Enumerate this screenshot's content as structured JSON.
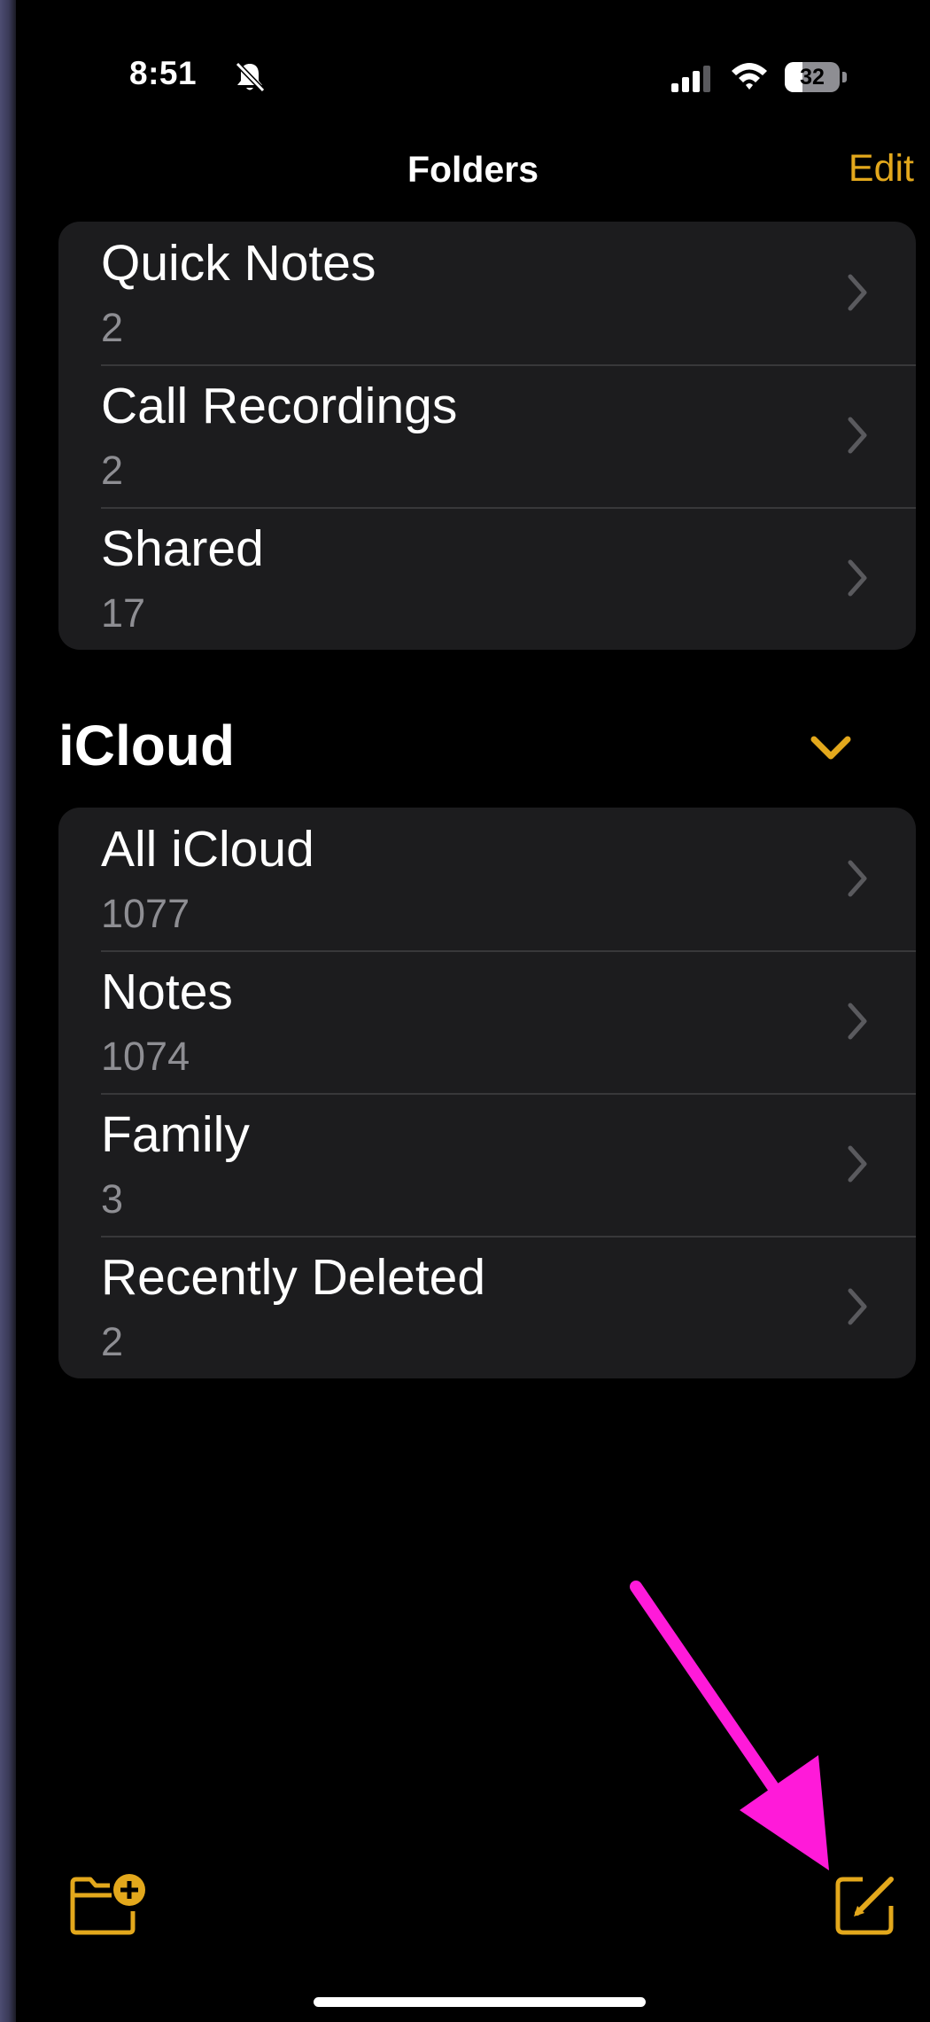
{
  "status_bar": {
    "time": "8:51",
    "battery_level": "32",
    "battery_fraction": 0.32,
    "icons": [
      "bell-slash-icon",
      "signal-icon",
      "wifi-icon",
      "battery-icon"
    ]
  },
  "nav": {
    "title": "Folders",
    "edit_label": "Edit"
  },
  "top_folders": [
    {
      "name": "Quick Notes",
      "count": "2"
    },
    {
      "name": "Call Recordings",
      "count": "2"
    },
    {
      "name": "Shared",
      "count": "17"
    }
  ],
  "icloud": {
    "title": "iCloud",
    "folders": [
      {
        "name": "All iCloud",
        "count": "1077"
      },
      {
        "name": "Notes",
        "count": "1074"
      },
      {
        "name": "Family",
        "count": "3"
      },
      {
        "name": "Recently Deleted",
        "count": "2"
      }
    ]
  },
  "toolbar": {
    "icons": [
      "new-folder-icon",
      "compose-icon"
    ]
  },
  "colors": {
    "accent": "#e3a81c",
    "background": "#000000",
    "group_background": "#1c1c1e",
    "secondary_text": "#8e8e93",
    "annotation_arrow": "#ff1ad9"
  }
}
